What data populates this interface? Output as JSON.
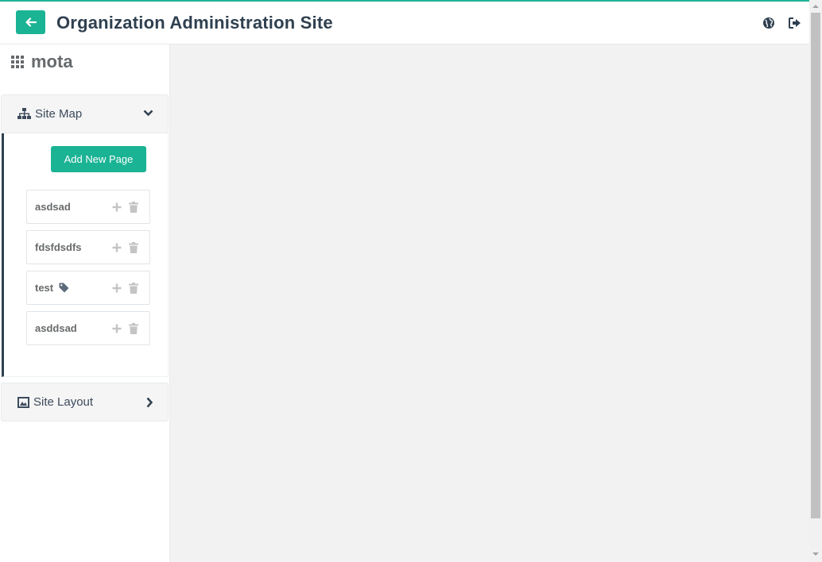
{
  "header": {
    "title": "Organization Administration Site",
    "back_icon": "arrow-left-icon",
    "globe_icon": "globe-icon",
    "logout_icon": "sign-out-icon"
  },
  "brand": {
    "name": "mota",
    "icon": "grid-icon"
  },
  "site_map": {
    "label": "Site Map",
    "icon": "sitemap-icon",
    "expanded": true,
    "add_button": "Add New Page",
    "pages": [
      {
        "name": "asdsad",
        "tagged": false
      },
      {
        "name": "fdsfdsdfs",
        "tagged": false
      },
      {
        "name": "test",
        "tagged": true
      },
      {
        "name": "asddsad",
        "tagged": false
      }
    ]
  },
  "site_layout": {
    "label": "Site Layout",
    "icon": "layout-icon",
    "expanded": false
  },
  "colors": {
    "accent": "#1ab394",
    "dark": "#2f4050",
    "content_bg": "#f2f2f2"
  }
}
